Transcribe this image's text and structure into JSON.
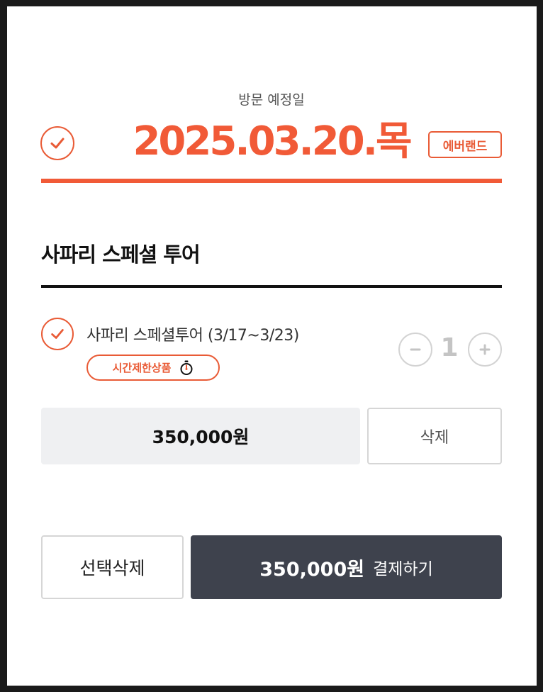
{
  "visit": {
    "label": "방문 예정일",
    "date": "2025.03.20.목",
    "park_badge": "에버랜드"
  },
  "product": {
    "title": "사파리 스페셜 투어",
    "item": {
      "name": "사파리 스페셜투어 (3/17~3/23)",
      "limited_badge": "시간제한상품",
      "quantity": "1",
      "minus_label": "−",
      "plus_label": "+",
      "price": "350,000원",
      "delete_label": "삭제"
    }
  },
  "footer": {
    "select_delete_label": "선택삭제",
    "pay_amount": "350,000원",
    "pay_label": "결제하기"
  },
  "colors": {
    "accent": "#f15a37",
    "dark_button": "#3e424d",
    "price_bg": "#eff0f2"
  }
}
